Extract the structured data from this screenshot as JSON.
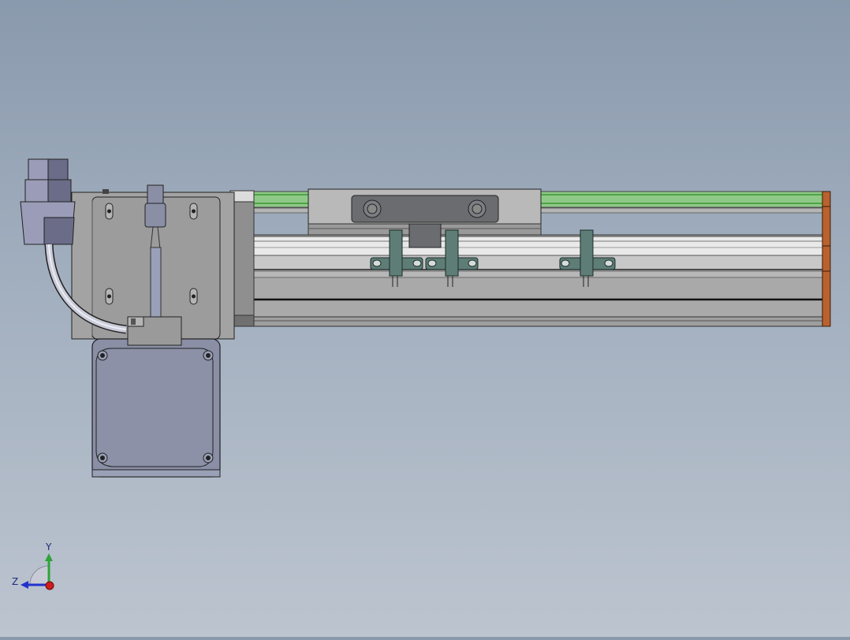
{
  "app": {
    "view": "cad-3d-viewport"
  },
  "colors": {
    "background_top": "#8a9aad",
    "background_bottom": "#bcc4cf",
    "motor_body": "#8a8fa6",
    "plate": "#9a9a9a",
    "rail": "#a8a8a8",
    "guide_green": "#6fc45f",
    "end_cap": "#b9622e",
    "sensor": "#5e7d76"
  },
  "triad": {
    "y_label": "Y",
    "z_label": "Z"
  }
}
